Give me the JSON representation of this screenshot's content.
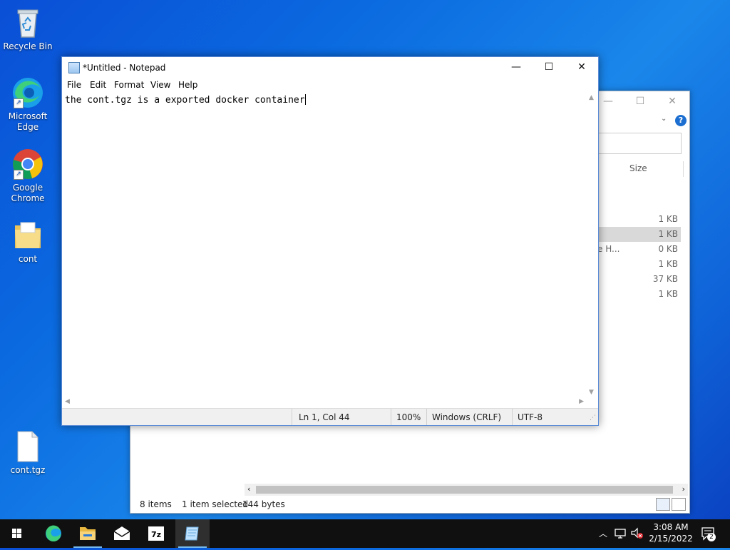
{
  "desktop": {
    "icons": [
      {
        "label": "Recycle Bin",
        "icon": "recycle-bin-icon"
      },
      {
        "label": "Microsoft Edge",
        "icon": "edge-icon"
      },
      {
        "label": "Google Chrome",
        "icon": "chrome-icon"
      },
      {
        "label": "cont",
        "icon": "folder-icon"
      },
      {
        "label": "cont.tgz",
        "icon": "file-icon"
      }
    ]
  },
  "notepad": {
    "title": "*Untitled - Notepad",
    "menu": [
      "File",
      "Edit",
      "Format",
      "View",
      "Help"
    ],
    "content": "the cont.tgz is a exported docker container",
    "status": {
      "position": "Ln 1, Col 44",
      "zoom": "100%",
      "line_ending": "Windows (CRLF)",
      "encoding": "UTF-8"
    }
  },
  "explorer": {
    "column_size": "Size",
    "rows": [
      {
        "name": "",
        "size": "1 KB",
        "selected": false
      },
      {
        "name": "",
        "size": "1 KB",
        "selected": true
      },
      {
        "name": "e H...",
        "size": "0 KB",
        "selected": false
      },
      {
        "name": "",
        "size": "1 KB",
        "selected": false
      },
      {
        "name": "",
        "size": "37 KB",
        "selected": false
      },
      {
        "name": "",
        "size": "1 KB",
        "selected": false
      }
    ],
    "status": {
      "items": "8 items",
      "selected": "1 item selected",
      "bytes": "144 bytes"
    }
  },
  "taskbar": {
    "apps": [
      "start-icon",
      "edge-icon",
      "file-explorer-icon",
      "mail-icon",
      "7zip-icon",
      "notepad-icon"
    ],
    "clock_time": "3:08 AM",
    "clock_date": "2/15/2022",
    "notification_count": "2"
  },
  "colors": {
    "taskbar": "#101010",
    "accent": "#76b9ed",
    "desktop": "#0b6be0"
  }
}
